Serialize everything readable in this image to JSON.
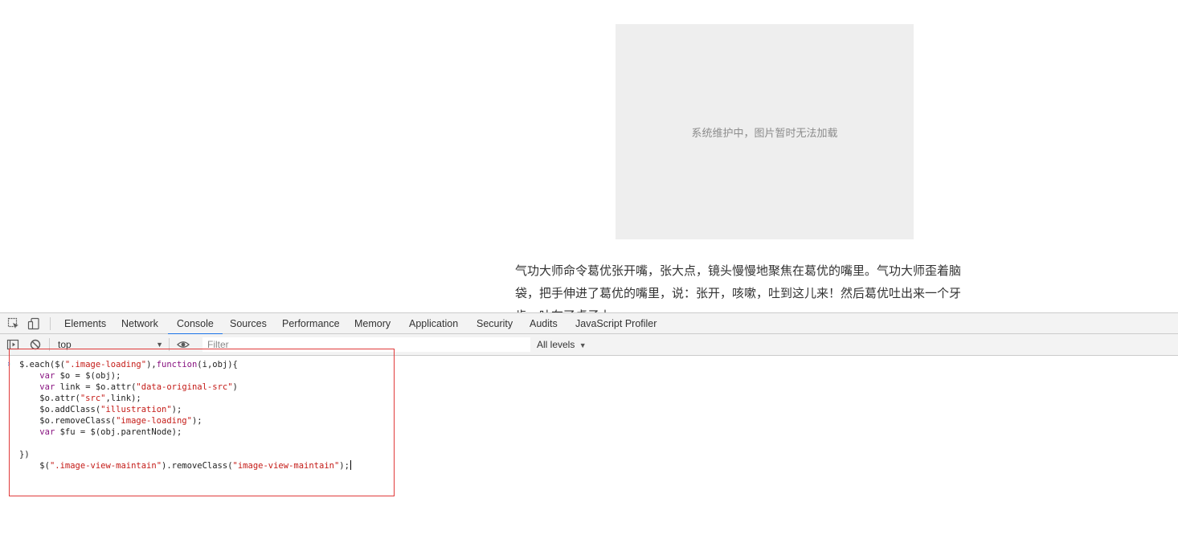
{
  "page": {
    "image_placeholder_text": "系统维护中，图片暂时无法加载",
    "article_lines": [
      "气功大师命令葛优张开嘴，张大点，镜头慢慢地聚焦在葛优的嘴里。气功大师歪着脑",
      "袋，把手伸进了葛优的嘴里，说：张开，咳嗽，吐到这儿来！然后葛优吐出来一个牙",
      "齿，吐在了桌子上"
    ]
  },
  "devtools": {
    "tabs": [
      {
        "label": "Elements"
      },
      {
        "label": "Network"
      },
      {
        "label": "Console",
        "active": true
      },
      {
        "label": "Sources"
      },
      {
        "label": "Performance"
      },
      {
        "label": "Memory"
      },
      {
        "label": "Application"
      },
      {
        "label": "Security"
      },
      {
        "label": "Audits"
      },
      {
        "label": "JavaScript Profiler"
      }
    ],
    "toolbar": {
      "context": "top",
      "filter_placeholder": "Filter",
      "levels": "All levels"
    },
    "console_code": [
      "$.each($(\".image-loading\"),function(i,obj){",
      "    var $o = $(obj);",
      "    var link = $o.attr(\"data-original-src\")",
      "    $o.attr(\"src\",link);",
      "    $o.addClass(\"illustration\");",
      "    $o.removeClass(\"image-loading\");",
      "    var $fu = $(obj.parentNode);",
      "",
      "})",
      "    $(\".image-view-maintain\").removeClass(\"image-view-maintain\");"
    ],
    "accent_color": "#1a73e8",
    "highlight_color": "#e03a3a"
  }
}
